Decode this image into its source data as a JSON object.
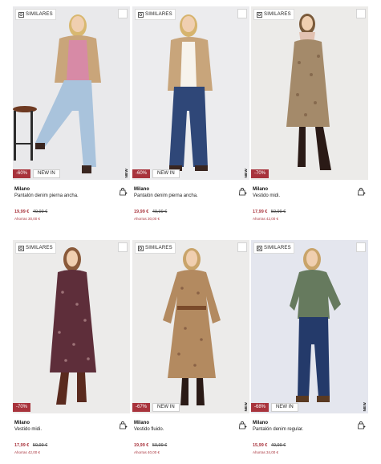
{
  "labels": {
    "similar": "SIMILARES",
    "new_in": "NEW IN",
    "new_vertical": "NEW"
  },
  "colors": {
    "discount_bg": "#a8333c",
    "price_now": "#a8333c"
  },
  "products": [
    {
      "brand": "Milano",
      "name": "Pantalón denim pierna ancha.",
      "discount": "-60%",
      "new_in": true,
      "price_now": "19,99 €",
      "price_old": "49,99 €",
      "savings": "Ahorras 30,00 €"
    },
    {
      "brand": "Milano",
      "name": "Pantalón denim pierna ancha.",
      "discount": "-60%",
      "new_in": true,
      "price_now": "19,99 €",
      "price_old": "49,99 €",
      "savings": "Ahorras 30,00 €"
    },
    {
      "brand": "Milano",
      "name": "Vestido midi.",
      "discount": "-70%",
      "new_in": false,
      "price_now": "17,99 €",
      "price_old": "59,99 €",
      "savings": "Ahorras 42,00 €"
    },
    {
      "brand": "Milano",
      "name": "Vestido midi.",
      "discount": "-70%",
      "new_in": false,
      "price_now": "17,99 €",
      "price_old": "59,99 €",
      "savings": "Ahorras 42,00 €"
    },
    {
      "brand": "Milano",
      "name": "Vestido fluido.",
      "discount": "-67%",
      "new_in": true,
      "price_now": "19,99 €",
      "price_old": "59,99 €",
      "savings": "Ahorras 40,00 €"
    },
    {
      "brand": "Milano",
      "name": "Pantalón denim regular.",
      "discount": "-68%",
      "new_in": true,
      "price_now": "15,99 €",
      "price_old": "49,99 €",
      "savings": "Ahorras 34,00 €"
    }
  ]
}
